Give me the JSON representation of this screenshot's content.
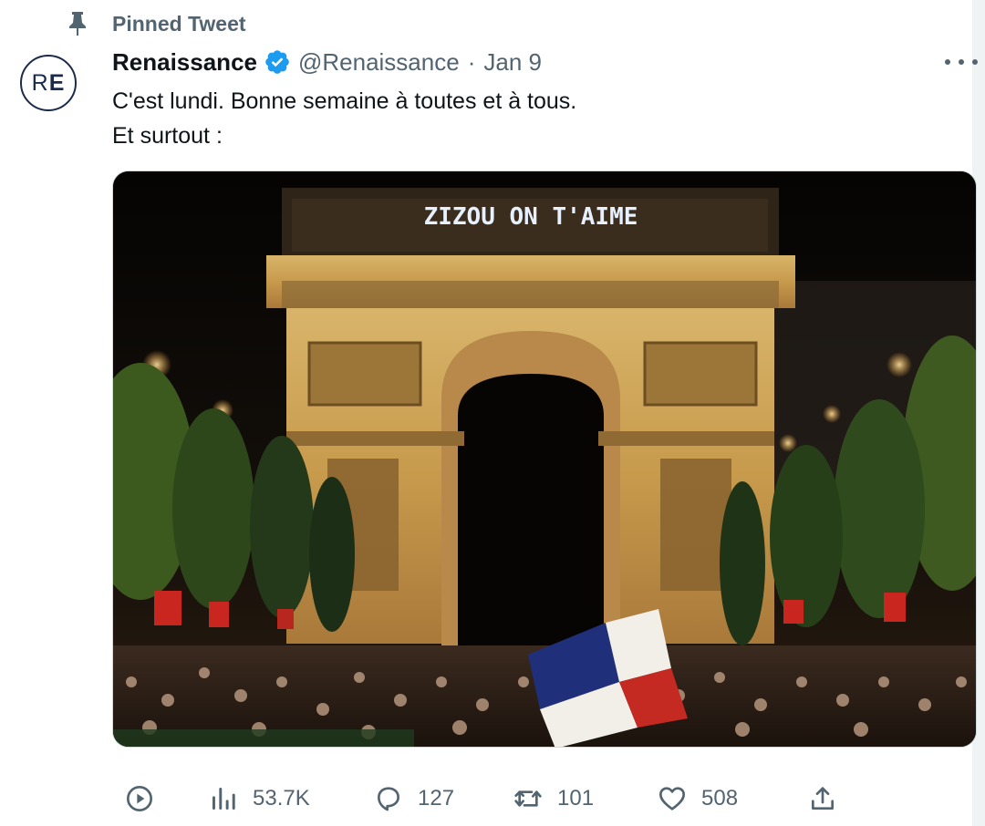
{
  "pinned": {
    "label": "Pinned Tweet",
    "icon": "pin-icon"
  },
  "author": {
    "avatar_text_light": "R",
    "avatar_text_bold": "E",
    "display_name": "Renaissance",
    "verified_icon": "verified-badge-icon",
    "handle": "@Renaissance",
    "separator": "·",
    "date": "Jan 9"
  },
  "tweet": {
    "line1": "C'est lundi. Bonne semaine à toutes et à tous.",
    "line2": "Et surtout :"
  },
  "media": {
    "description_icon": "photo-arc-de-triomphe",
    "projection_text": "ZIZOU ON T'AIME"
  },
  "actions": {
    "play_icon": "play-icon",
    "views": "53.7K",
    "replies": "127",
    "retweets": "101",
    "likes": "508",
    "share_icon": "share-icon"
  },
  "colors": {
    "text_primary": "#0f1419",
    "text_secondary": "#536471",
    "verified": "#1d9bf0",
    "brand_navy": "#1c2b4a"
  }
}
